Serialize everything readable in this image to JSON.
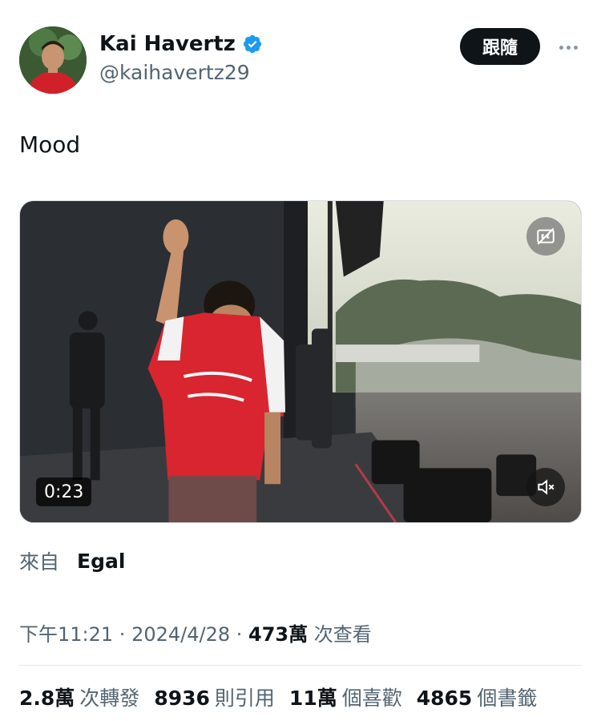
{
  "author": {
    "name": "Kai Havertz",
    "handle": "@kaihavertz29",
    "verified": true,
    "avatar_icon": "profile-photo"
  },
  "actions": {
    "follow_label": "跟隨",
    "more_icon": "ellipsis-icon"
  },
  "tweet": {
    "text": "Mood"
  },
  "media": {
    "duration": "0:23",
    "caption_icon": "captions-off-icon",
    "mute_icon": "volume-muted-icon"
  },
  "source": {
    "label": "來自",
    "name": "Egal"
  },
  "meta": {
    "time": "下午11:21",
    "sep1": " · ",
    "date": "2024/4/28",
    "sep2": " · ",
    "views_count": "473萬",
    "views_label": " 次查看"
  },
  "stats": [
    {
      "count": "2.8萬",
      "label": "次轉發"
    },
    {
      "count": "8936",
      "label": "則引用"
    },
    {
      "count": "11萬",
      "label": "個喜歡"
    },
    {
      "count": "4865",
      "label": "個書籤"
    }
  ],
  "colors": {
    "text_primary": "#0f1419",
    "text_secondary": "#536471",
    "verified_blue": "#1d9bf0",
    "follow_bg": "#0f1419"
  }
}
